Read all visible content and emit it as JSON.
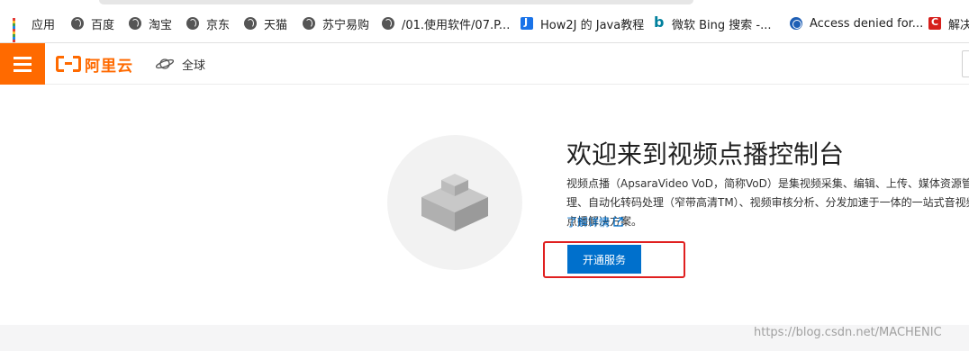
{
  "bookmarks": {
    "apps_label": "应用",
    "items": [
      {
        "label": "百度",
        "icon": "globe-icon"
      },
      {
        "label": "淘宝",
        "icon": "globe-icon"
      },
      {
        "label": "京东",
        "icon": "globe-icon"
      },
      {
        "label": "天猫",
        "icon": "globe-icon"
      },
      {
        "label": "苏宁易购",
        "icon": "globe-icon"
      },
      {
        "label": "/01.使用软件/07.P...",
        "icon": "globe-icon"
      },
      {
        "label": "How2J 的 Java教程",
        "icon": "how2j-icon"
      },
      {
        "label": "微软 Bing 搜索 -...",
        "icon": "bing-icon"
      },
      {
        "label": "Access denied for...",
        "icon": "access-denied-icon"
      },
      {
        "label": "解决",
        "icon": "csdn-icon"
      }
    ]
  },
  "header": {
    "brand": "阿里云",
    "region": "全球"
  },
  "main": {
    "title": "欢迎来到视频点播控制台",
    "description": "视频点播（ApsaraVideo VoD，简称VoD）是集视频采集、编辑、上传、媒体资源管理、自动化转码处理（窄带高清TM）、视频审核分析、分发加速于一体的一站式音视频点播解决方案。",
    "learn_more": "了解详情",
    "open_service": "开通服务"
  },
  "watermark": "https://blog.csdn.net/MACHENIC",
  "colors": {
    "brand_orange": "#ff6a00",
    "primary_blue": "#0070cc",
    "highlight_red": "#e02020"
  }
}
